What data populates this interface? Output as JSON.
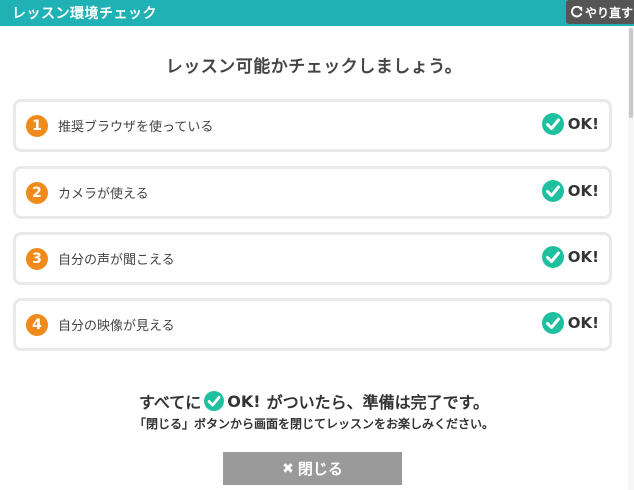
{
  "header": {
    "title": "レッスン環境チェック",
    "redo_label": "やり直す"
  },
  "main": {
    "title": "レッスン可能かチェックしましょう。",
    "items": [
      {
        "number": "1",
        "label": "推奨ブラウザを使っている",
        "status": "OK!"
      },
      {
        "number": "2",
        "label": "カメラが使える",
        "status": "OK!"
      },
      {
        "number": "3",
        "label": "自分の声が聞こえる",
        "status": "OK!"
      },
      {
        "number": "4",
        "label": "自分の映像が見える",
        "status": "OK!"
      }
    ],
    "summary_before": "すべてに",
    "summary_ok": "OK!",
    "summary_after": "がついたら、準備は完了です。",
    "summary_sub": "「閉じる」ボタンから画面を閉じてレッスンをお楽しみください。",
    "close_label": "閉じる"
  },
  "colors": {
    "header": "#1fb1b4",
    "badge": "#f08a1a",
    "check": "#1fc0a0",
    "button": "#9a9a9a"
  }
}
